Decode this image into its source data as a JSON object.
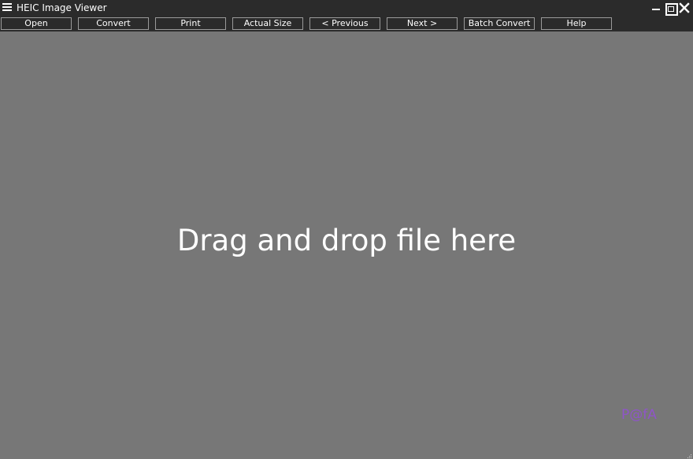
{
  "titlebar": {
    "title": "HEIC Image Viewer",
    "menu_icon": "hamburger-menu-icon",
    "controls": {
      "minimize_icon": "minimize-icon",
      "maximize_icon": "maximize-icon",
      "close_icon": "close-icon"
    }
  },
  "toolbar": {
    "buttons": [
      {
        "label": "Open"
      },
      {
        "label": "Convert"
      },
      {
        "label": "Print"
      },
      {
        "label": "Actual Size"
      },
      {
        "label": "< Previous"
      },
      {
        "label": "Next >"
      },
      {
        "label": "Batch Convert"
      },
      {
        "label": "Help"
      }
    ]
  },
  "main": {
    "drop_text": "Drag and drop file here",
    "watermark": "P@fA"
  },
  "colors": {
    "chrome_background": "#2b2b2b",
    "canvas_background": "#777777",
    "button_border": "#9a9a9a",
    "text": "#ffffff",
    "watermark": "#8f55c8"
  }
}
